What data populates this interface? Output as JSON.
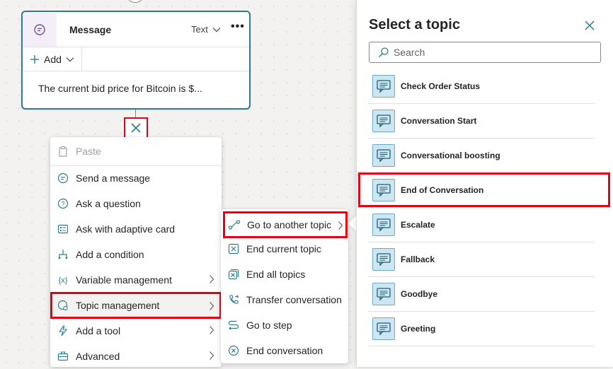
{
  "message_node": {
    "title": "Message",
    "type_label": "Text",
    "more_label": "•••",
    "add_label": "Add",
    "body_text": "The current bid price for Bitcoin is $..."
  },
  "context_menu": {
    "items": [
      {
        "label": "Paste",
        "icon": "paste-icon"
      },
      {
        "label": "Send a message",
        "icon": "message-icon"
      },
      {
        "label": "Ask a question",
        "icon": "question-icon"
      },
      {
        "label": "Ask with adaptive card",
        "icon": "card-icon"
      },
      {
        "label": "Add a condition",
        "icon": "branch-icon"
      },
      {
        "label": "Variable management",
        "icon": "variable-icon"
      },
      {
        "label": "Topic management",
        "icon": "topic-icon"
      },
      {
        "label": "Add a tool",
        "icon": "tool-icon"
      },
      {
        "label": "Advanced",
        "icon": "briefcase-icon"
      }
    ]
  },
  "topic_submenu": {
    "items": [
      {
        "label": "Go to another topic",
        "icon": "link-icon"
      },
      {
        "label": "End current topic",
        "icon": "end-topic-icon"
      },
      {
        "label": "End all topics",
        "icon": "end-all-icon"
      },
      {
        "label": "Transfer conversation",
        "icon": "phone-transfer-icon"
      },
      {
        "label": "Go to step",
        "icon": "step-icon"
      },
      {
        "label": "End conversation",
        "icon": "end-conversation-icon"
      }
    ]
  },
  "topic_panel": {
    "title": "Select a topic",
    "search_placeholder": "Search",
    "topics": [
      "Check Order Status",
      "Conversation Start",
      "Conversational boosting",
      "End of Conversation",
      "Escalate",
      "Fallback",
      "Goodbye",
      "Greeting"
    ]
  },
  "colors": {
    "accent": "#2b7c8c",
    "highlight": "#e60012",
    "topic_icon_bg": "#cde6f2"
  }
}
